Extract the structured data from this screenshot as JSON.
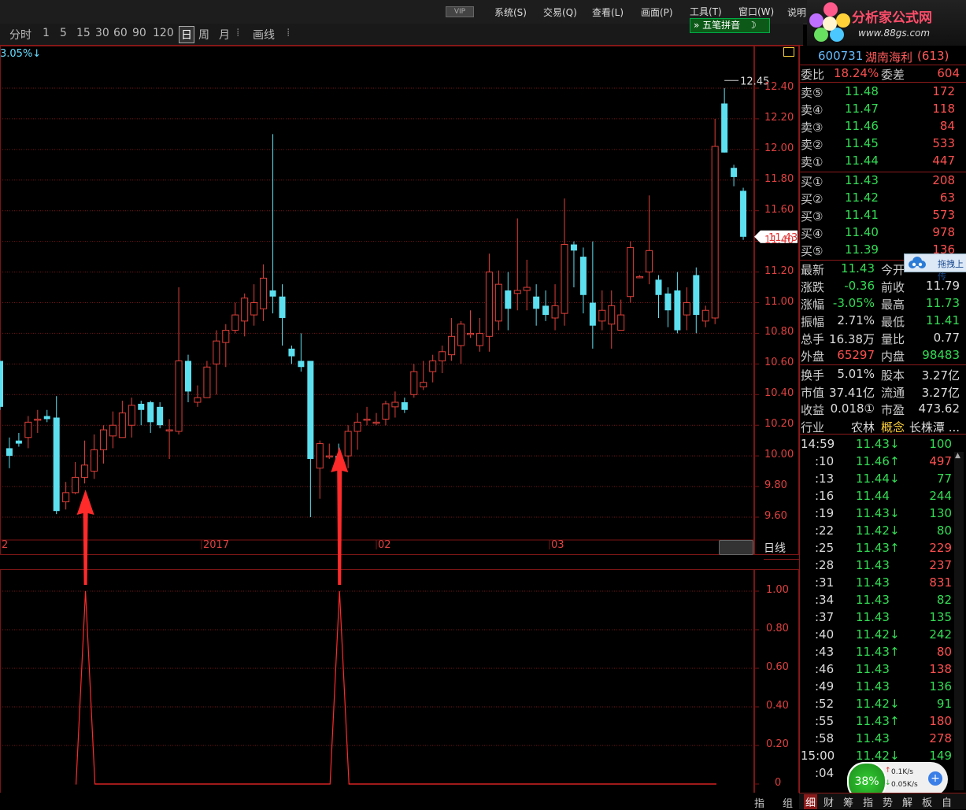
{
  "menubar": {
    "vip": "VIP",
    "items": [
      "系统(S)",
      "交易(Q)",
      "查看(L)",
      "画面(P)",
      "工具(T)",
      "窗口(W)",
      "说明"
    ]
  },
  "toolbar": {
    "periods": [
      "分时",
      "1",
      "5",
      "15",
      "30",
      "60",
      "90",
      "120"
    ],
    "day": "日",
    "week": "周",
    "month": "月",
    "draw": "画线",
    "ime": "五笔拼音"
  },
  "logo": {
    "title": "分析家公式网",
    "url": "www.88gs.com"
  },
  "chart": {
    "pct_change": "3.05%↓",
    "ticks": [
      "12.40",
      "12.20",
      "12.00",
      "11.80",
      "11.60",
      "11.40",
      "11.20",
      "11.00",
      "10.80",
      "10.60",
      "10.40",
      "10.20",
      "10.00",
      "9.80",
      "9.60"
    ],
    "tick_values": [
      12.4,
      12.2,
      12.0,
      11.8,
      11.6,
      11.4,
      11.2,
      11.0,
      10.8,
      10.6,
      10.4,
      10.2,
      10.0,
      9.8,
      9.6
    ],
    "max_label": "12.45",
    "last_price_tag": "11.43",
    "x_labels": [
      "2",
      "2017",
      "02",
      "03"
    ],
    "period_label": "日线",
    "candles": [
      [
        10.62,
        10.32,
        10.62,
        10.3
      ],
      [
        10.05,
        10.0,
        10.12,
        9.92
      ],
      [
        10.1,
        10.08,
        10.15,
        10.06
      ],
      [
        10.12,
        10.22,
        10.26,
        10.05
      ],
      [
        10.24,
        10.24,
        10.3,
        10.15
      ],
      [
        10.26,
        10.24,
        10.3,
        10.22
      ],
      [
        10.25,
        9.64,
        10.39,
        9.62
      ],
      [
        9.7,
        9.76,
        9.83,
        9.65
      ],
      [
        9.76,
        9.86,
        9.96,
        9.75
      ],
      [
        9.86,
        9.94,
        10.1,
        9.82
      ],
      [
        9.9,
        10.04,
        10.14,
        9.85
      ],
      [
        10.04,
        10.17,
        10.2,
        9.95
      ],
      [
        10.13,
        10.2,
        10.29,
        10.05
      ],
      [
        10.12,
        10.28,
        10.36,
        10.12
      ],
      [
        10.2,
        10.33,
        10.38,
        10.12
      ],
      [
        10.34,
        10.3,
        10.36,
        10.2
      ],
      [
        10.35,
        10.22,
        10.36,
        10.15
      ],
      [
        10.32,
        10.2,
        10.35,
        10.18
      ],
      [
        10.17,
        10.17,
        10.24,
        9.98
      ],
      [
        10.16,
        10.62,
        11.1,
        10.14
      ],
      [
        10.62,
        10.42,
        10.66,
        10.35
      ],
      [
        10.35,
        10.38,
        10.46,
        10.32
      ],
      [
        10.38,
        10.58,
        10.62,
        10.38
      ],
      [
        10.6,
        10.75,
        10.82,
        10.4
      ],
      [
        10.74,
        10.82,
        10.86,
        10.58
      ],
      [
        10.82,
        10.92,
        11.0,
        10.8
      ],
      [
        10.88,
        11.03,
        11.06,
        10.78
      ],
      [
        10.92,
        11.0,
        11.12,
        10.85
      ],
      [
        10.96,
        11.16,
        11.25,
        10.88
      ],
      [
        11.08,
        11.04,
        12.1,
        10.93
      ],
      [
        11.04,
        10.9,
        11.12,
        10.72
      ],
      [
        10.7,
        10.65,
        10.72,
        10.6
      ],
      [
        10.62,
        10.58,
        10.8,
        10.55
      ],
      [
        10.62,
        9.98,
        10.62,
        9.6
      ],
      [
        9.92,
        10.08,
        10.1,
        9.72
      ],
      [
        10.0,
        10.0,
        10.08,
        9.98
      ],
      [
        10.0,
        9.98,
        10.08,
        9.9
      ],
      [
        10.0,
        10.16,
        10.2,
        9.92
      ],
      [
        10.16,
        10.22,
        10.28,
        10.04
      ],
      [
        10.24,
        10.24,
        10.32,
        10.2
      ],
      [
        10.22,
        10.22,
        10.28,
        10.2
      ],
      [
        10.24,
        10.34,
        10.36,
        10.2
      ],
      [
        10.32,
        10.35,
        10.42,
        10.25
      ],
      [
        10.35,
        10.3,
        10.38,
        10.28
      ],
      [
        10.4,
        10.55,
        10.6,
        10.38
      ],
      [
        10.45,
        10.48,
        10.62,
        10.43
      ],
      [
        10.55,
        10.62,
        10.66,
        10.48
      ],
      [
        10.62,
        10.68,
        10.72,
        10.54
      ],
      [
        10.66,
        10.78,
        10.9,
        10.62
      ],
      [
        10.72,
        10.86,
        10.88,
        10.6
      ],
      [
        10.8,
        10.8,
        10.95,
        10.77
      ],
      [
        10.72,
        10.8,
        10.9,
        10.68
      ],
      [
        10.78,
        11.2,
        11.32,
        10.68
      ],
      [
        10.88,
        11.12,
        11.21,
        10.82
      ],
      [
        11.08,
        10.96,
        11.2,
        10.82
      ],
      [
        11.06,
        11.08,
        11.55,
        10.95
      ],
      [
        11.08,
        11.1,
        11.28,
        10.95
      ],
      [
        11.04,
        10.96,
        11.12,
        10.85
      ],
      [
        10.98,
        10.92,
        11.08,
        10.88
      ],
      [
        10.9,
        10.98,
        11.12,
        10.82
      ],
      [
        10.93,
        11.38,
        11.68,
        10.85
      ],
      [
        11.38,
        11.34,
        11.4,
        11.1
      ],
      [
        11.3,
        11.05,
        11.36,
        10.93
      ],
      [
        11.0,
        10.85,
        11.4,
        10.7
      ],
      [
        10.88,
        10.95,
        11.08,
        10.82
      ],
      [
        10.86,
        10.98,
        11.08,
        10.7
      ],
      [
        10.82,
        10.92,
        11.02,
        10.82
      ],
      [
        11.04,
        11.36,
        11.4,
        11.0
      ],
      [
        11.17,
        11.17,
        11.18,
        11.16
      ],
      [
        11.2,
        11.34,
        11.7,
        11.12
      ],
      [
        11.15,
        11.05,
        11.18,
        10.9
      ],
      [
        11.06,
        10.95,
        11.1,
        10.84
      ],
      [
        11.08,
        10.82,
        11.2,
        10.8
      ],
      [
        10.92,
        11.0,
        11.1,
        10.82
      ],
      [
        11.18,
        10.92,
        11.23,
        10.8
      ],
      [
        10.88,
        10.95,
        10.98,
        10.84
      ],
      [
        10.9,
        12.02,
        12.2,
        10.86
      ],
      [
        12.3,
        11.98,
        12.4,
        11.98
      ],
      [
        11.88,
        11.82,
        11.9,
        11.76
      ],
      [
        11.73,
        11.43,
        11.75,
        11.41
      ]
    ]
  },
  "indicator": {
    "ticks": [
      "1.00",
      "0.80",
      "0.60",
      "0.40",
      "0.20",
      "0"
    ],
    "tick_values": [
      1.0,
      0.8,
      0.6,
      0.4,
      0.2,
      0.0
    ],
    "signals": [
      8,
      35
    ],
    "label": "指",
    "label2": "组"
  },
  "info": {
    "code": "600731",
    "name": "湖南海利",
    "count": "(613)",
    "ratio_label": "委比",
    "ratio": "18.24%",
    "diff_label": "委差",
    "diff": "604",
    "asks": [
      {
        "label": "卖⑤",
        "price": "11.48",
        "vol": "172"
      },
      {
        "label": "卖④",
        "price": "11.47",
        "vol": "118"
      },
      {
        "label": "卖③",
        "price": "11.46",
        "vol": "84"
      },
      {
        "label": "卖②",
        "price": "11.45",
        "vol": "533"
      },
      {
        "label": "卖①",
        "price": "11.44",
        "vol": "447"
      }
    ],
    "bids": [
      {
        "label": "买①",
        "price": "11.43",
        "vol": "208"
      },
      {
        "label": "买②",
        "price": "11.42",
        "vol": "63"
      },
      {
        "label": "买③",
        "price": "11.41",
        "vol": "573"
      },
      {
        "label": "买④",
        "price": "11.40",
        "vol": "978"
      },
      {
        "label": "买⑤",
        "price": "11.39",
        "vol": "136"
      }
    ],
    "quote": [
      {
        "l1": "最新",
        "v1": "11.43",
        "c1": "green",
        "l2": "今开",
        "v2": "",
        "c2": "red"
      },
      {
        "l1": "涨跌",
        "v1": "-0.36",
        "c1": "green",
        "l2": "前收",
        "v2": "11.79",
        "c2": "white"
      },
      {
        "l1": "涨幅",
        "v1": "-3.05%",
        "c1": "green",
        "l2": "最高",
        "v2": "11.73",
        "c2": "green"
      },
      {
        "l1": "振幅",
        "v1": "2.71%",
        "c1": "white",
        "l2": "最低",
        "v2": "11.41",
        "c2": "green"
      },
      {
        "l1": "总手",
        "v1": "16.38万",
        "c1": "white",
        "l2": "量比",
        "v2": "0.77",
        "c2": "white"
      },
      {
        "l1": "外盘",
        "v1": "65297",
        "c1": "red",
        "l2": "内盘",
        "v2": "98483",
        "c2": "green"
      }
    ],
    "fund": [
      {
        "l1": "换手",
        "v1": "5.01%",
        "l2": "股本",
        "v2": "3.27亿"
      },
      {
        "l1": "市值",
        "v1": "37.41亿",
        "l2": "流通",
        "v2": "3.27亿"
      },
      {
        "l1": "收益",
        "v1": "0.018①",
        "l2": "市盈",
        "v2": "473.62"
      },
      {
        "l1": "行业",
        "v1": "农林",
        "l2": "概念",
        "v2": "长株潭 ..."
      }
    ],
    "upload": "拖拽上传",
    "ticks": [
      {
        "t": "14:59",
        "p": "11.43↓",
        "pc": "green",
        "v": "100",
        "vc": "green"
      },
      {
        "t": ":10",
        "p": "11.46↑",
        "pc": "green",
        "v": "497",
        "vc": "red"
      },
      {
        "t": ":13",
        "p": "11.44↓",
        "pc": "green",
        "v": "77",
        "vc": "green"
      },
      {
        "t": ":16",
        "p": "11.44",
        "pc": "green",
        "v": "244",
        "vc": "green"
      },
      {
        "t": ":19",
        "p": "11.43↓",
        "pc": "green",
        "v": "130",
        "vc": "green"
      },
      {
        "t": ":22",
        "p": "11.42↓",
        "pc": "green",
        "v": "80",
        "vc": "green"
      },
      {
        "t": ":25",
        "p": "11.43↑",
        "pc": "green",
        "v": "229",
        "vc": "red"
      },
      {
        "t": ":28",
        "p": "11.43",
        "pc": "green",
        "v": "237",
        "vc": "red"
      },
      {
        "t": ":31",
        "p": "11.43",
        "pc": "green",
        "v": "831",
        "vc": "red"
      },
      {
        "t": ":34",
        "p": "11.43",
        "pc": "green",
        "v": "82",
        "vc": "green"
      },
      {
        "t": ":37",
        "p": "11.43",
        "pc": "green",
        "v": "135",
        "vc": "green"
      },
      {
        "t": ":40",
        "p": "11.42↓",
        "pc": "green",
        "v": "242",
        "vc": "green"
      },
      {
        "t": ":43",
        "p": "11.43↑",
        "pc": "green",
        "v": "80",
        "vc": "red"
      },
      {
        "t": ":46",
        "p": "11.43",
        "pc": "green",
        "v": "138",
        "vc": "red"
      },
      {
        "t": ":49",
        "p": "11.43",
        "pc": "green",
        "v": "136",
        "vc": "green"
      },
      {
        "t": ":52",
        "p": "11.42↓",
        "pc": "green",
        "v": "91",
        "vc": "green"
      },
      {
        "t": ":55",
        "p": "11.43↑",
        "pc": "green",
        "v": "180",
        "vc": "red"
      },
      {
        "t": ":58",
        "p": "11.43",
        "pc": "green",
        "v": "278",
        "vc": "red"
      },
      {
        "t": "15:00",
        "p": "11.42↓",
        "pc": "green",
        "v": "149",
        "vc": "green"
      },
      {
        "t": ":04",
        "p": "",
        "pc": "green",
        "v": "",
        "vc": "green"
      }
    ],
    "speed": {
      "percent": "38%",
      "up": "0.1K/s",
      "down": "0.05K/s"
    },
    "tabs": [
      "细",
      "财",
      "筹",
      "指",
      "势",
      "解",
      "板",
      "自"
    ]
  },
  "colors": {
    "up": "#e0403a",
    "down": "#5ce0f0",
    "grid": "#7a1515",
    "signal": "#ff2a2a"
  }
}
